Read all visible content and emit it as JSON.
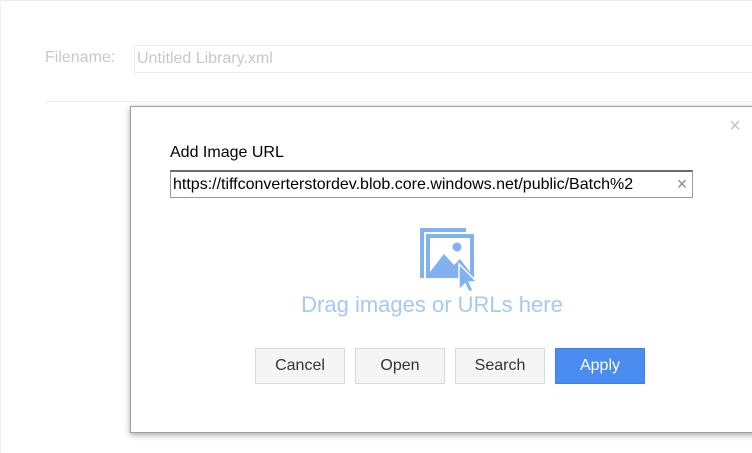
{
  "background": {
    "filename_label": "Filename:",
    "filename_value": "Untitled Library.xml"
  },
  "dialog": {
    "title": "Add Image URL",
    "url_value": "https://tiffconverterstordev.blob.core.windows.net/public/Batch%2",
    "clear_glyph": "×",
    "close_glyph": "×",
    "drop_icon": "image-drop-icon",
    "drop_text": "Drag images or URLs here",
    "buttons": {
      "cancel": "Cancel",
      "open": "Open",
      "search": "Search",
      "apply": "Apply"
    }
  },
  "colors": {
    "accent": "#4a8cf0",
    "drop_hint": "#a5c8f5",
    "muted_text": "#c8c8c8"
  }
}
